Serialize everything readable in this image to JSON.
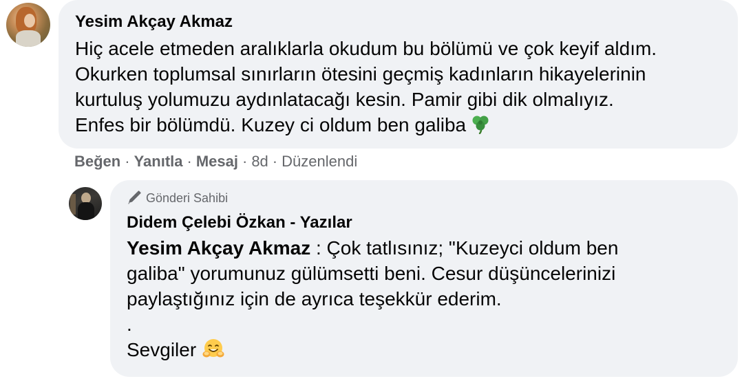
{
  "comment": {
    "author": "Yesim Akçay Akmaz",
    "lines": [
      "Hiç acele etmeden aralıklarla okudum bu bölümü ve çok keyif aldım.",
      "Okurken toplumsal sınırların ötesini geçmiş kadınların hikayelerinin",
      "kurtuluş yolumuzu aydınlatacağı kesin. Pamir gibi dik olmalıyız.",
      "Enfes bir bölümdü. Kuzey ci oldum ben galiba"
    ],
    "emoji": "shamrock-icon",
    "actions": {
      "like": "Beğen",
      "reply": "Yanıtla",
      "message": "Mesaj",
      "time": "8d",
      "edited": "Düzenlendi",
      "separator": "·"
    }
  },
  "reply": {
    "badge": "Gönderi Sahibi",
    "badge_icon": "pencil-icon",
    "author": "Didem Çelebi Özkan - Yazılar",
    "mention": "Yesim Akçay Akmaz",
    "first_line_rest": " : Çok tatlısınız; \"Kuzeyci oldum ben",
    "lines": [
      "galiba\" yorumunuz gülümsetti beni. Cesur düşüncelerinizi",
      "paylaştığınız için de ayrıca teşekkür ederim.",
      "."
    ],
    "closing": "Sevgiler",
    "closing_emoji": "hugging-face-icon"
  },
  "colors": {
    "bubble_bg": "#f0f2f5",
    "text": "#050505",
    "secondary": "#65676b"
  }
}
